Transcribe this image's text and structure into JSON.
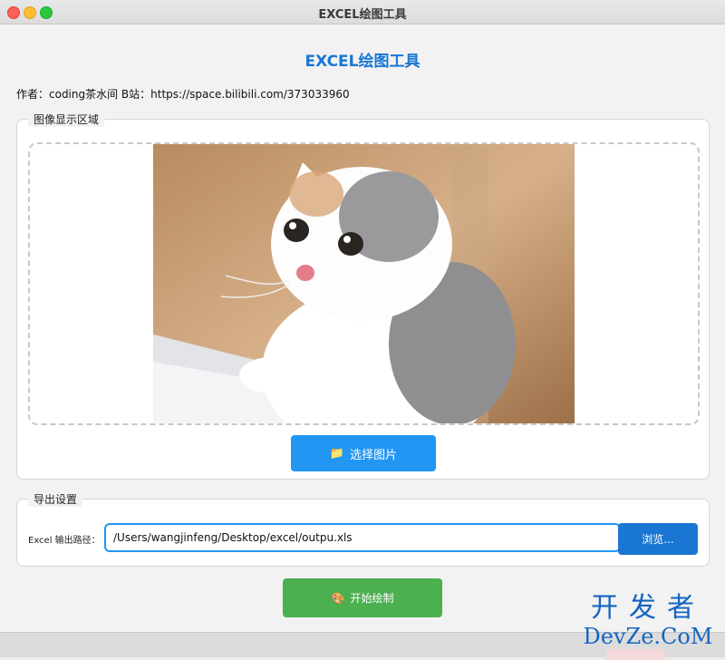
{
  "window": {
    "title": "EXCEL绘图工具"
  },
  "app": {
    "title": "EXCEL绘图工具",
    "author_line": "作者：coding茶水间 B站：https://space.bilibili.com/373033960"
  },
  "image_area": {
    "legend": "图像显示区域",
    "select_button_icon": "📁",
    "select_button_label": "选择图片"
  },
  "export": {
    "legend": "导出设置",
    "path_label": "Excel 输出路径：",
    "path_value": "/Users/wangjinfeng/Desktop/excel/outpu.xls",
    "browse_label": "浏览..."
  },
  "actions": {
    "start_icon": "🎨",
    "start_label": "开始绘制"
  },
  "watermark": {
    "line1": "开发者",
    "line2": "DevZe.CoM"
  },
  "colors": {
    "accent_blue": "#1976d2",
    "select_blue": "#2196f3",
    "start_green": "#4caf50"
  }
}
